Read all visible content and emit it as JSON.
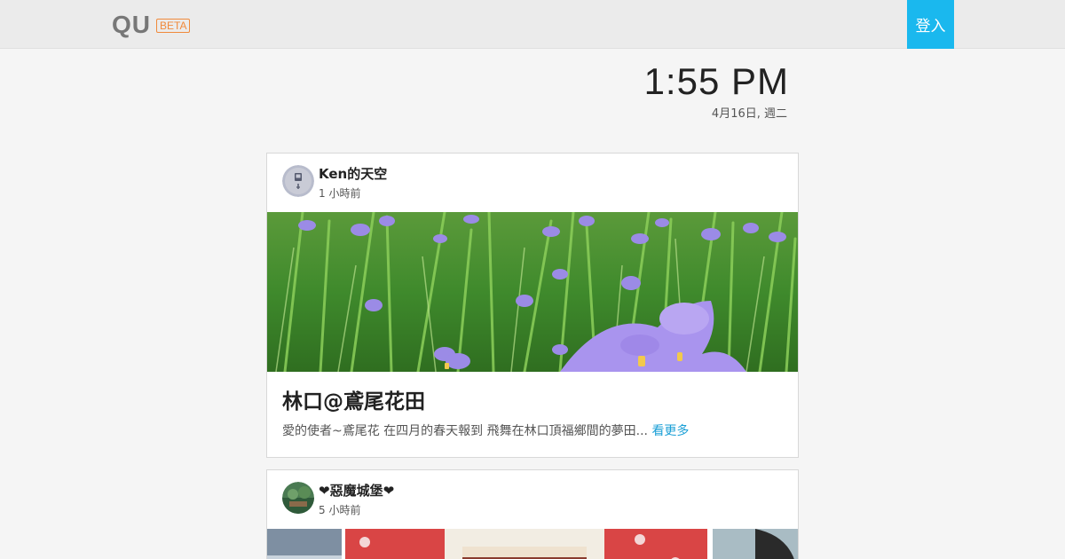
{
  "header": {
    "logo": "QU",
    "beta_badge": "BETA",
    "login_label": "登入"
  },
  "clock": {
    "time": "1:55 PM",
    "date": "4月16日, 週二"
  },
  "posts": [
    {
      "author": "Ken的天空",
      "time_ago": "1 小時前",
      "title": "林口@鳶尾花田",
      "excerpt": "愛的使者~鳶尾花 在四月的春天報到 飛舞在林口頂福鄉間的夢田...",
      "more_label": "看更多"
    },
    {
      "author": "❤惡魔城堡❤",
      "time_ago": "5 小時前"
    }
  ]
}
